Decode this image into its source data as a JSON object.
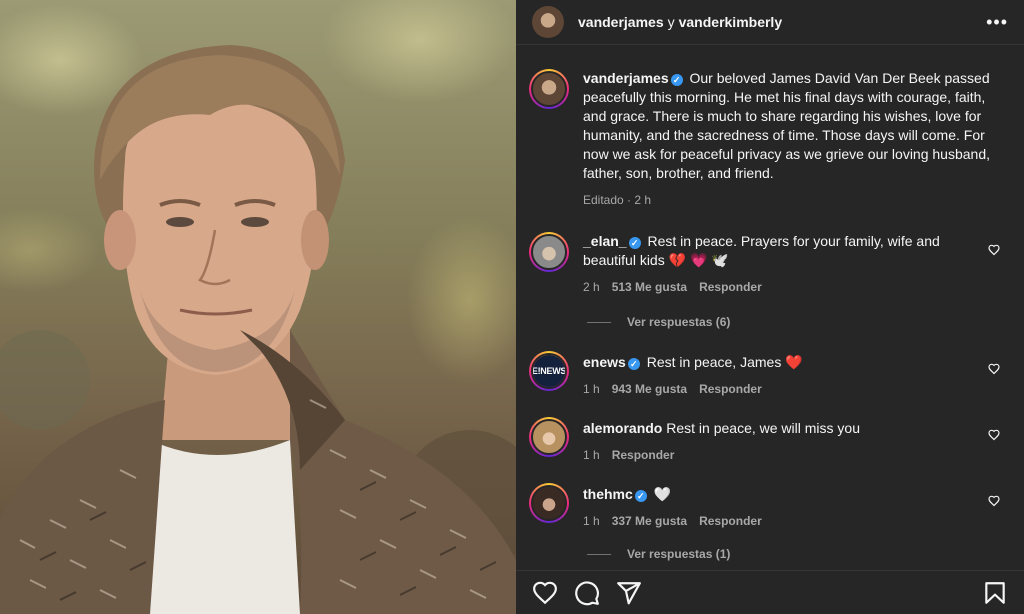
{
  "header": {
    "user1": "vanderjames",
    "connector": "y",
    "user2": "vanderkimberly",
    "more_icon": "more-horizontal-icon"
  },
  "caption": {
    "username": "vanderjames",
    "verified": true,
    "text": "Our beloved James David Van Der Beek passed peacefully this morning. He met his final days with courage, faith, and grace. There is much to share regarding his wishes, love for humanity, and the sacredness of time. Those days will come. For now we ask for peaceful privacy as we grieve our loving husband, father, son, brother, and friend.",
    "meta": "Editado · 2 h"
  },
  "comments": [
    {
      "username": "_elan_",
      "verified": true,
      "text": "Rest in peace. Prayers for your family, wife and beautiful kids",
      "emoji": [
        "💔",
        "💗",
        "🕊️"
      ],
      "time": "2 h",
      "likes": "513 Me gusta",
      "reply": "Responder",
      "view_replies": "Ver respuestas (6)"
    },
    {
      "username": "enews",
      "verified": true,
      "text": "Rest in peace, James",
      "emoji": [
        "❤️"
      ],
      "avatar_text": "E!NEWS",
      "time": "1 h",
      "likes": "943 Me gusta",
      "reply": "Responder"
    },
    {
      "username": "alemorando",
      "verified": false,
      "text": "Rest in peace, we will miss you",
      "time": "1 h",
      "reply": "Responder"
    },
    {
      "username": "thehmc",
      "verified": true,
      "text": "",
      "emoji": [
        "🤍"
      ],
      "time": "1 h",
      "likes": "337 Me gusta",
      "reply": "Responder",
      "view_replies": "Ver respuestas (1)"
    }
  ],
  "actions": {
    "like_icon": "heart-outline-icon",
    "comment_icon": "comment-icon",
    "share_icon": "paper-plane-icon",
    "save_icon": "bookmark-icon"
  },
  "colors": {
    "panel_bg": "#262626",
    "verified_blue": "#3897f0",
    "muted_text": "#a8a8a8"
  }
}
